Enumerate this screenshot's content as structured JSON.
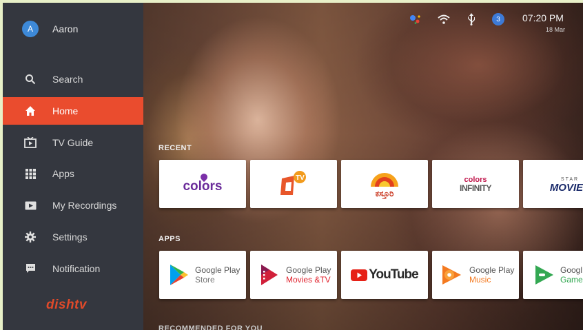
{
  "profile": {
    "initial": "A",
    "name": "Aaron"
  },
  "sidebar": {
    "items": [
      {
        "label": "Search",
        "icon": "search-icon"
      },
      {
        "label": "Home",
        "icon": "home-icon"
      },
      {
        "label": "TV Guide",
        "icon": "tv-guide-icon"
      },
      {
        "label": "Apps",
        "icon": "apps-grid-icon"
      },
      {
        "label": "My Recordings",
        "icon": "recordings-icon"
      },
      {
        "label": "Settings",
        "icon": "settings-gear-icon"
      },
      {
        "label": "Notification",
        "icon": "notification-icon"
      }
    ],
    "active": "Home",
    "brand": "dishtv"
  },
  "status": {
    "notification_count": "3",
    "time": "07:20 PM",
    "date": "18 Mar"
  },
  "rows": {
    "recent": {
      "title": "RECENT",
      "cards": [
        {
          "name": "colors",
          "label": "colors"
        },
        {
          "name": "channel-tv",
          "label": "TV"
        },
        {
          "name": "kasthuri",
          "label": "ಕಸ್ತೂರಿ"
        },
        {
          "name": "colors-infinity",
          "label_top": "colors",
          "label_bottom": "INFINITY"
        },
        {
          "name": "star-movies",
          "label_top": "STAR",
          "label_bottom": "MOVIES"
        }
      ]
    },
    "apps": {
      "title": "APPS",
      "cards": [
        {
          "line1": "Google Play",
          "line2": "Store",
          "color": "#777777"
        },
        {
          "line1": "Google Play",
          "line2": "Movies &TV",
          "color": "#e0202b"
        },
        {
          "label": "YouTube"
        },
        {
          "line1": "Google Play",
          "line2": "Music",
          "color": "#f47a20"
        },
        {
          "line1": "Googl",
          "line2": "Games",
          "color": "#33a852"
        }
      ]
    },
    "recommended": {
      "title": "RECOMMENDED FOR YOU"
    }
  },
  "colors": {
    "accent": "#ea4c2e",
    "sidebar": "#34373f",
    "badge": "#3d7ad6"
  }
}
